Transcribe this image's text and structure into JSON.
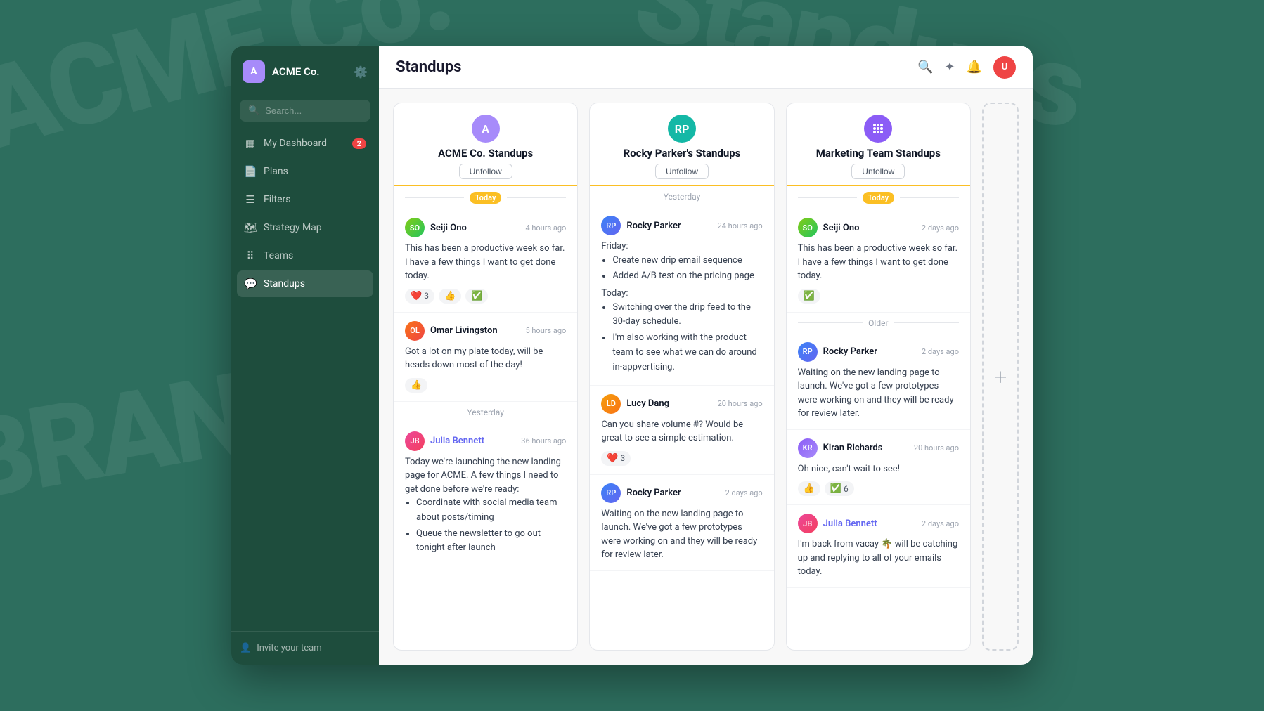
{
  "app": {
    "company": "ACME Co.",
    "page_title": "Standups"
  },
  "sidebar": {
    "logo_letter": "A",
    "search_placeholder": "Search...",
    "nav_items": [
      {
        "label": "My Dashboard",
        "icon": "grid",
        "badge": 2,
        "active": false
      },
      {
        "label": "Plans",
        "icon": "doc",
        "badge": null,
        "active": false
      },
      {
        "label": "Filters",
        "icon": "list",
        "badge": null,
        "active": false
      },
      {
        "label": "Strategy Map",
        "icon": "map",
        "badge": null,
        "active": false
      },
      {
        "label": "Teams",
        "icon": "dots",
        "badge": null,
        "active": false
      },
      {
        "label": "Standups",
        "icon": "chat",
        "badge": null,
        "active": true
      }
    ],
    "invite_label": "Invite your team"
  },
  "topbar": {
    "title": "Standups"
  },
  "columns": [
    {
      "id": "acme",
      "avatar_letter": "A",
      "avatar_class": "purple",
      "title": "ACME Co. Standups",
      "unfollow_label": "Unfollow",
      "time_badge": "Today",
      "posts": [
        {
          "user": "Seiji Ono",
          "avatar_class": "av-seiji",
          "time": "4 hours ago",
          "text": "This has been a productive week so far. I have a few things I want to get done today.",
          "reactions": [
            {
              "emoji": "❤️",
              "count": 3
            },
            {
              "emoji": "👍",
              "count": null
            },
            {
              "emoji": "✅",
              "count": null
            }
          ]
        },
        {
          "user": "Omar Livingston",
          "avatar_class": "av-omar",
          "time": "5 hours ago",
          "text": "Got a lot on my plate today, will be heads down most of the day!",
          "reactions": [
            {
              "emoji": "👍",
              "count": null
            }
          ]
        }
      ],
      "older_label": "Yesterday",
      "older_posts": [
        {
          "user": "Julia Bennett",
          "avatar_class": "av-julia",
          "time": "36 hours ago",
          "linked": true,
          "text_before": "Today we're launching the new landing page for ACME. A few things I need to get done before we're ready:",
          "list": [
            "Coordinate with social media team about posts/timing",
            "Queue the newsletter to go out tonight after launch"
          ]
        }
      ]
    },
    {
      "id": "rocky",
      "avatar_letter": "RP",
      "avatar_class": "teal",
      "title": "Rocky Parker's Standups",
      "unfollow_label": "Unfollow",
      "time_badge": "Yesterday",
      "posts": [
        {
          "user": "Rocky Parker",
          "avatar_class": "av-rocky",
          "time": "24 hours ago",
          "sections": [
            {
              "label": "Friday:",
              "items": [
                "Create new drip email sequence",
                "Added A/B test on the pricing page"
              ]
            },
            {
              "label": "Today:",
              "items": [
                "Switching over the drip feed to the 30-day schedule.",
                "I'm also working with the product team to see what we can do around in-appvertising."
              ]
            }
          ],
          "reactions": []
        },
        {
          "user": "Lucy Dang",
          "avatar_class": "av-lucy",
          "time": "20 hours ago",
          "text": "Can you share volume #? Would be great to see a simple estimation.",
          "reactions": [
            {
              "emoji": "❤️",
              "count": 3
            }
          ]
        },
        {
          "user": "Rocky Parker",
          "avatar_class": "av-rocky",
          "time": "2 days ago",
          "text": "Waiting on the new landing page to launch. We've got a few prototypes were working on and they will be ready for review later.",
          "reactions": []
        }
      ]
    },
    {
      "id": "marketing",
      "avatar_letter": "🟣",
      "avatar_class": "violet",
      "title": "Marketing Team Standups",
      "unfollow_label": "Unfollow",
      "time_badge": "Today",
      "posts": [
        {
          "user": "Seiji Ono",
          "avatar_class": "av-seiji",
          "time": "2 days ago",
          "text": "This has been a productive week so far. I have a few things I want to get done today.",
          "reactions": [
            {
              "emoji": "✅",
              "count": null
            }
          ]
        }
      ],
      "older_label": "Older",
      "older_posts": [
        {
          "user": "Rocky Parker",
          "avatar_class": "av-rocky",
          "time": "2 days ago",
          "linked": false,
          "text": "Waiting on the new landing page to launch. We've got a few prototypes were working on and they will be ready for review later.",
          "reactions": []
        },
        {
          "user": "Kiran Richards",
          "avatar_class": "av-kiran",
          "time": "20 hours ago",
          "linked": false,
          "text": "Oh nice, can't wait to see!",
          "reactions": [
            {
              "emoji": "👍",
              "count": null
            },
            {
              "emoji": "✅",
              "count": 6
            }
          ]
        },
        {
          "user": "Julia Bennett",
          "avatar_class": "av-julia",
          "time": "2 days ago",
          "linked": true,
          "text": "I'm back from vacay 🌴 will be catching up and replying to all of your emails today.",
          "reactions": []
        }
      ]
    }
  ]
}
